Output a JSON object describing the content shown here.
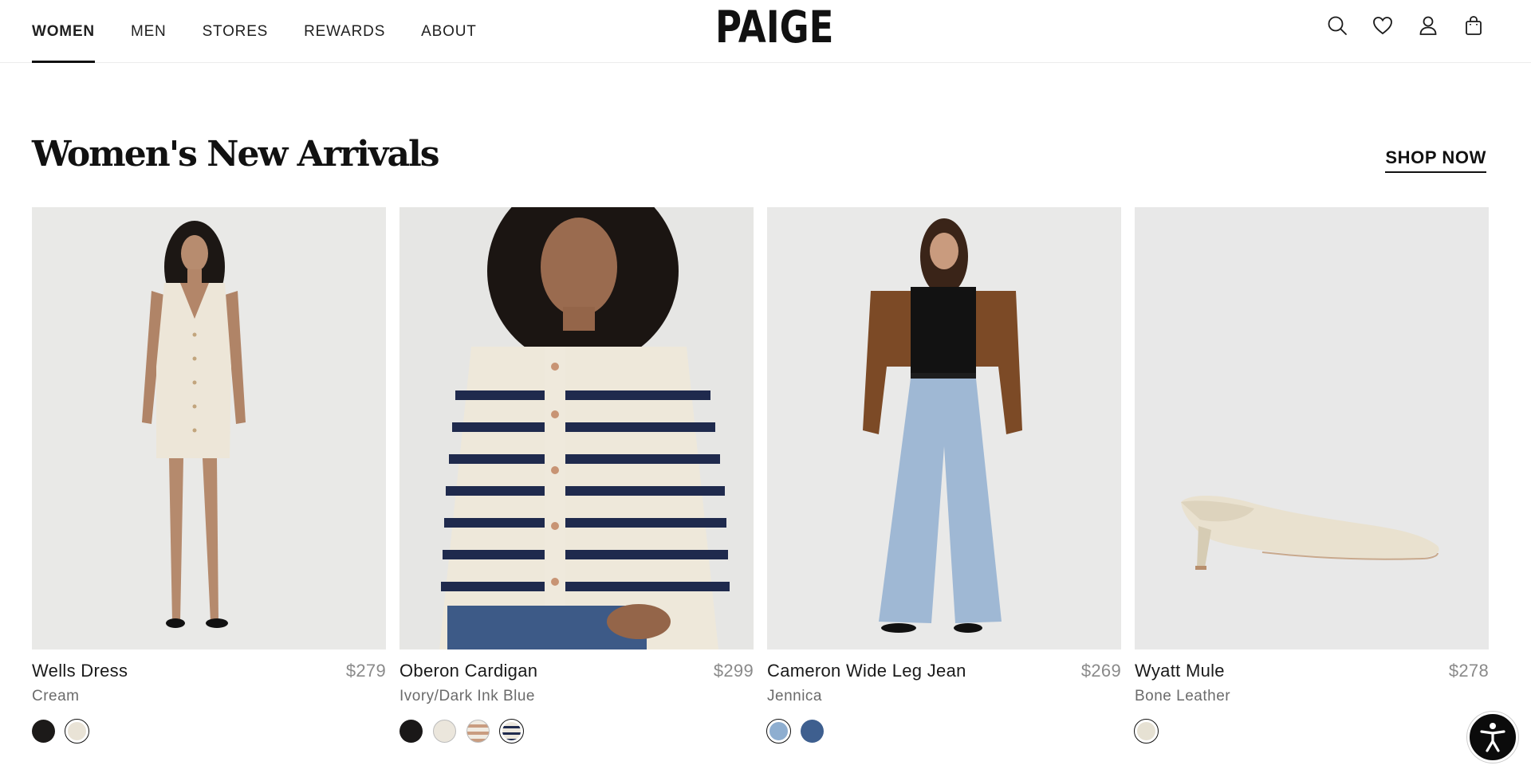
{
  "nav": {
    "items": [
      {
        "label": "WOMEN",
        "active": true
      },
      {
        "label": "MEN",
        "active": false
      },
      {
        "label": "STORES",
        "active": false
      },
      {
        "label": "REWARDS",
        "active": false
      },
      {
        "label": "ABOUT",
        "active": false
      }
    ],
    "logo": "PAIGE",
    "icons": [
      "search-icon",
      "heart-icon",
      "account-icon",
      "shopping-bag-icon"
    ]
  },
  "section": {
    "title": "Women's New Arrivals",
    "cta": "SHOP NOW"
  },
  "products": [
    {
      "name": "Wells Dress",
      "price": "$279",
      "color": "Cream",
      "swatches": [
        {
          "color": "#1c1a19",
          "selected": false
        },
        {
          "color": "#e9e3d6",
          "selected": true
        }
      ]
    },
    {
      "name": "Oberon Cardigan",
      "price": "$299",
      "color": "Ivory/Dark Ink Blue",
      "swatches": [
        {
          "color": "#1a1818",
          "selected": false
        },
        {
          "color": "#ebe6dc",
          "selected": false
        },
        {
          "color": "#d8b9a3",
          "selected": false
        },
        {
          "color": "#e3ded4",
          "selected": true
        }
      ]
    },
    {
      "name": "Cameron Wide Leg Jean",
      "price": "$269",
      "color": "Jennica",
      "swatches": [
        {
          "color": "#8eaed0",
          "selected": true
        },
        {
          "color": "#3e5f8f",
          "selected": false
        }
      ]
    },
    {
      "name": "Wyatt Mule",
      "price": "$278",
      "color": "Bone Leather",
      "swatches": [
        {
          "color": "#e6e1d3",
          "selected": true
        }
      ]
    }
  ],
  "colors": {
    "accent": "#111111",
    "photo_bg": "#ebebeb",
    "price": "#8a8a8a"
  }
}
